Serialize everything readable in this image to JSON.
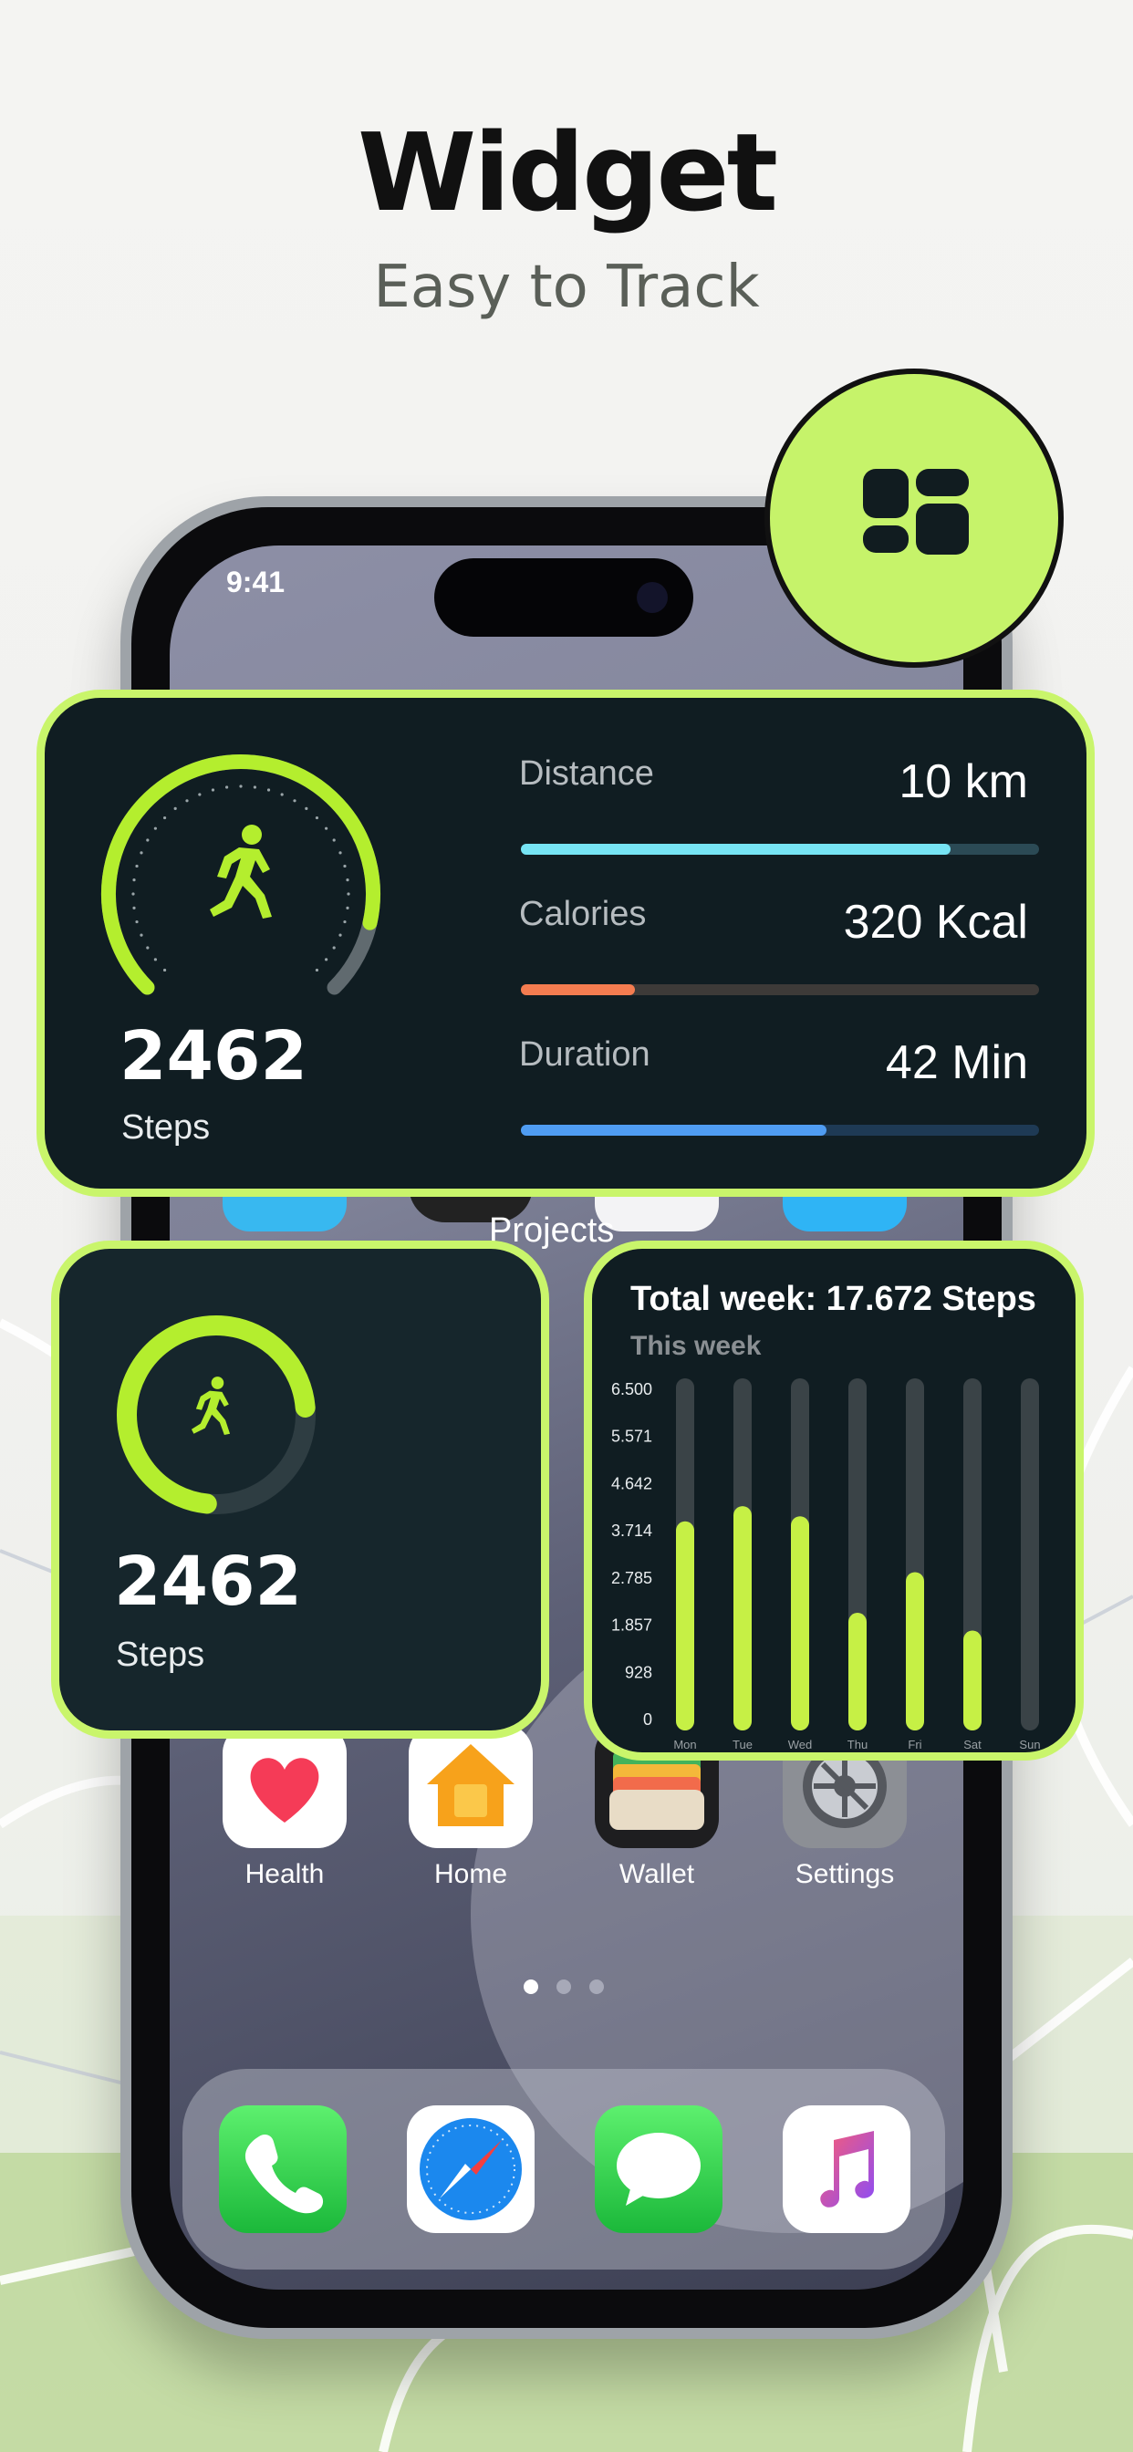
{
  "header": {
    "title": "Widget",
    "subtitle": "Easy to Track"
  },
  "status_bar": {
    "time": "9:41"
  },
  "widget_large": {
    "steps": "2462",
    "steps_label": "Steps",
    "progress": 0.88,
    "metrics": [
      {
        "label": "Distance",
        "value": "10 km",
        "progress": 0.83,
        "color": "#76e4f4",
        "track": "#2b4a55"
      },
      {
        "label": "Calories",
        "value": "320 Kcal",
        "progress": 0.22,
        "color": "#f47c50",
        "track": "#3d3a38"
      },
      {
        "label": "Duration",
        "value": "42 Min",
        "progress": 0.59,
        "color": "#4f9cf2",
        "track": "#1e3a55"
      }
    ]
  },
  "widget_small": {
    "steps": "2462",
    "steps_label": "Steps",
    "progress": 0.72
  },
  "partial_label": "Projects",
  "apps": [
    {
      "name": "Health"
    },
    {
      "name": "Home"
    },
    {
      "name": "Wallet"
    },
    {
      "name": "Settings"
    }
  ],
  "page_dots": {
    "count": 3,
    "active": 0
  },
  "dock": [
    "phone-icon",
    "safari-icon",
    "messages-icon",
    "music-icon"
  ],
  "colors": {
    "accent": "#c6f36a",
    "card_bg": "#101d22",
    "bar_fill": "#c6f045",
    "bar_track": "#3a4347"
  },
  "chart_data": {
    "type": "bar",
    "title": "Total week: 17.672 Steps",
    "subtitle": "This week",
    "categories": [
      "Mon",
      "Tue",
      "Wed",
      "Thu",
      "Fri",
      "Sat",
      "Sun"
    ],
    "values": [
      3900,
      4200,
      4000,
      2100,
      2900,
      1750,
      0
    ],
    "y_ticks": [
      "6.500",
      "5.571",
      "4.642",
      "3.714",
      "2.785",
      "1.857",
      "928",
      "0"
    ],
    "ylim": [
      0,
      6500
    ],
    "grid": false
  }
}
